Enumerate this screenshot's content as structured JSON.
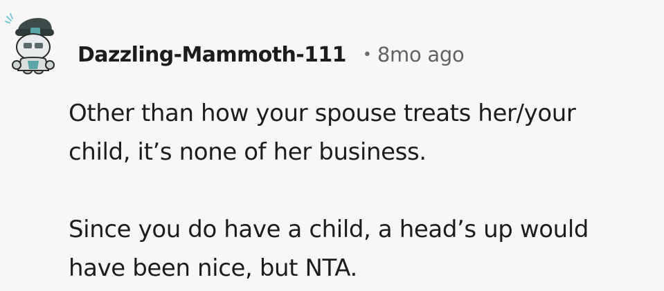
{
  "comment": {
    "author": "Dazzling-Mammoth-111",
    "separator": "•",
    "timestamp": "8mo ago",
    "paragraphs": [
      [
        "Other than how your spouse treats her/your",
        "child, it’s none of her business."
      ],
      [
        "Since you do have a child, a head’s up would",
        "have been nice, but NTA."
      ]
    ]
  },
  "avatar": {
    "icon": "snoo-avatar-icon",
    "colors": {
      "hat": "#3c4a4a",
      "body": "#e9ecec",
      "accent": "#5aa6a6",
      "sparkle": "#7cc7d6"
    }
  }
}
